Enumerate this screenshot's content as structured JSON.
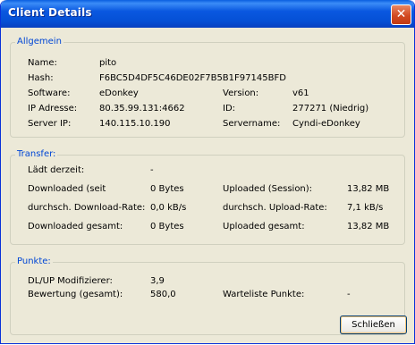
{
  "window": {
    "title": "Client Details",
    "close_symbol": "✕"
  },
  "allgemein": {
    "heading": "Allgemein",
    "name_label": "Name:",
    "name_value": "pito",
    "hash_label": "Hash:",
    "hash_value": "F6BC5D4DF5C46DE02F7B5B1F97145BFD",
    "software_label": "Software:",
    "software_value": "eDonkey",
    "version_label": "Version:",
    "version_value": "v61",
    "ip_label": "IP Adresse:",
    "ip_value": "80.35.99.131:4662",
    "id_label": "ID:",
    "id_value": "277271 (Niedrig)",
    "serverip_label": "Server IP:",
    "serverip_value": "140.115.10.190",
    "servername_label": "Servername:",
    "servername_value": "Cyndi-eDonkey"
  },
  "transfer": {
    "heading": "Transfer:",
    "laedt_label": "Lädt derzeit:",
    "laedt_value": "-",
    "downloaded_label": "Downloaded (seit",
    "downloaded_value": "0 Bytes",
    "uploaded_session_label": "Uploaded (Session):",
    "uploaded_session_value": "13,82 MB",
    "avg_down_label": "durchsch. Download-Rate:",
    "avg_down_value": "0,0 kB/s",
    "avg_up_label": "durchsch. Upload-Rate:",
    "avg_up_value": "7,1 kB/s",
    "down_total_label": "Downloaded gesamt:",
    "down_total_value": "0 Bytes",
    "up_total_label": "Uploaded gesamt:",
    "up_total_value": "13,82 MB"
  },
  "punkte": {
    "heading": "Punkte:",
    "modifier_label": "DL/UP Modifizierer:",
    "modifier_value": "3,9",
    "rating_label": "Bewertung (gesamt):",
    "rating_value": "580,0",
    "queue_label": "Warteliste Punkte:",
    "queue_value": "-"
  },
  "buttons": {
    "close_label": "Schließen"
  }
}
